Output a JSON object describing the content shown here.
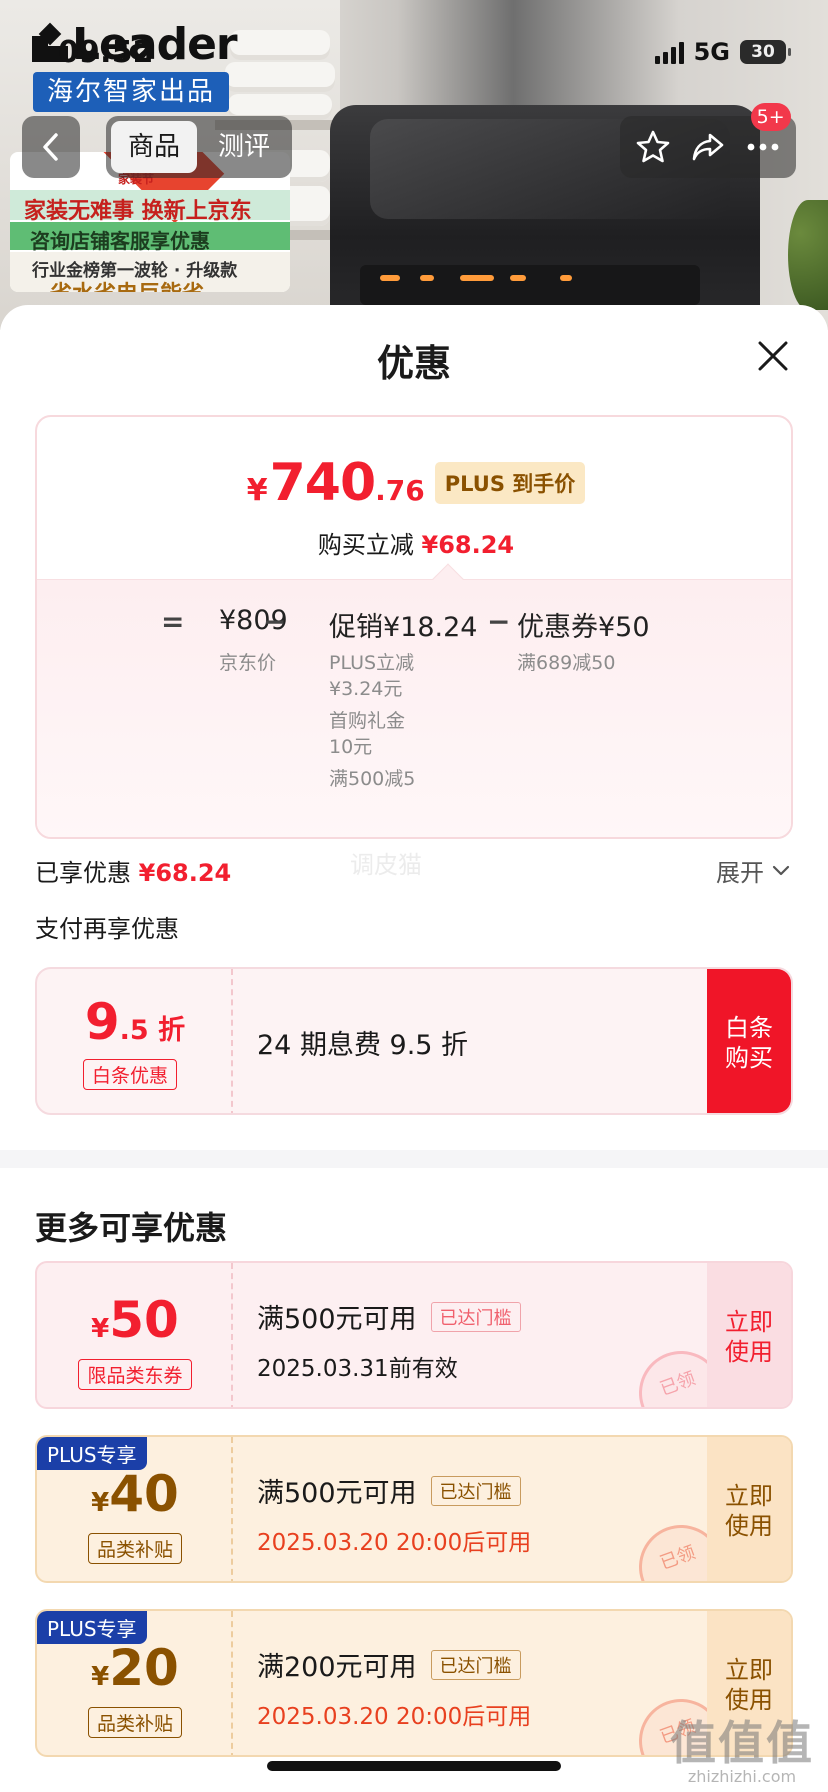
{
  "status_bar": {
    "time": "09:52",
    "network": "5G",
    "battery": "30"
  },
  "header": {
    "brand_logo": "Leader",
    "brand_tag": "海尔智家出品",
    "poster_lines": [
      "家装节",
      "家装无难事 换新上京东",
      "咨询店铺客服享优惠",
      "行业金榜第一波轮 · 升级款",
      "省水省电巨能省"
    ]
  },
  "nav": {
    "back_icon": "chevron-left-icon",
    "tabs": [
      {
        "label": "商品",
        "active": true
      },
      {
        "label": "测评",
        "active": false
      }
    ],
    "actions": [
      "star-icon",
      "share-icon",
      "more-icon"
    ],
    "badge": "5+"
  },
  "sheet": {
    "title": "优惠",
    "close_icon": "close-icon",
    "price_card": {
      "currency": "¥",
      "price_int": "740",
      "price_dec": ".76",
      "plus_tag": "PLUS 到手价",
      "buy_cut_label": "购买立减",
      "buy_cut_amount": "¥68.24",
      "breakdown": {
        "eq": "=",
        "jd_price": "¥809",
        "jd_price_label": "京东价",
        "minus": "−",
        "promo": "促销¥18.24",
        "promo_notes": [
          "PLUS立减",
          "¥3.24元",
          "首购礼金",
          "10元",
          "满500减5"
        ],
        "coupon": "优惠券¥50",
        "coupon_note": "满689减50"
      }
    },
    "enjoyed_label": "已享优惠",
    "enjoyed_amount": "¥68.24",
    "expand_label": "展开",
    "faint_watermark": "调皮猫",
    "pay_more_label": "支付再享优惠",
    "baitiao": {
      "rate_int": "9",
      "rate_dec": ".5 折",
      "tag": "白条优惠",
      "text": "24 期息费 9.5 折",
      "button_line1": "白条",
      "button_line2": "购买"
    },
    "more_title": "更多可享优惠",
    "coupons": [
      {
        "style": "red",
        "plus": "",
        "yen": "¥",
        "amount": "50",
        "type": "限品类东券",
        "condition": "满500元可用",
        "reached": "已达门槛",
        "date": "2025.03.31前有效",
        "use_line1": "立即",
        "use_line2": "使用",
        "stamp": "已领"
      },
      {
        "style": "gold",
        "plus": "PLUS专享",
        "yen": "¥",
        "amount": "40",
        "type": "品类补贴",
        "condition": "满500元可用",
        "reached": "已达门槛",
        "date": "2025.03.20 20:00后可用",
        "use_line1": "立即",
        "use_line2": "使用",
        "stamp": "已领"
      },
      {
        "style": "gold",
        "plus": "PLUS专享",
        "yen": "¥",
        "amount": "20",
        "type": "品类补贴",
        "condition": "满200元可用",
        "reached": "已达门槛",
        "date": "2025.03.20 20:00后可用",
        "use_line1": "立即",
        "use_line2": "使用",
        "stamp": "已领"
      }
    ]
  },
  "site_watermark": {
    "glyphs": "值值值",
    "url": "zhizhizhi.com"
  },
  "colors": {
    "accent_red": "#f21f2f",
    "plus_gold": "#8a5100",
    "plus_blue": "#1b3fa8",
    "brand_blue": "#1d5fb8"
  }
}
